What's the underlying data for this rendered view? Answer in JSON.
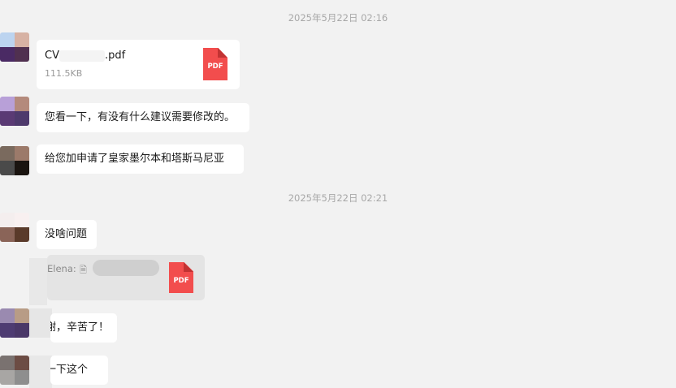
{
  "timestamps": [
    "2025年5月22日 02:16",
    "2025年5月22日 02:21"
  ],
  "messages": {
    "file1": {
      "name_prefix": "CV",
      "name_suffix": ".pdf",
      "size": "111.5KB",
      "icon_label": "PDF"
    },
    "msg1": "您看一下，有没有什么建议需要修改的。",
    "msg2": "给您加申请了皇家墨尔本和塔斯马尼亚",
    "msg3": "没啥问题",
    "quote": {
      "author": "Elena:",
      "icon_label": "PDF"
    },
    "msg4": "谢，辛苦了！",
    "msg5": "一下这个"
  },
  "colors": {
    "background": "#f2f2f2",
    "bubble": "#ffffff",
    "timestamp": "#a8a8a8",
    "pdf_red": "#f24d4d"
  }
}
